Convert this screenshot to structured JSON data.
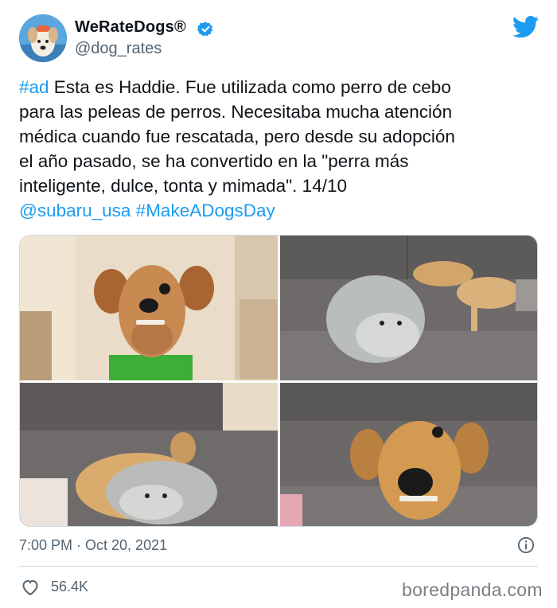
{
  "account": {
    "display_name": "WeRateDogs®",
    "handle": "@dog_rates"
  },
  "tweet": {
    "lines": [
      {
        "link": "#ad",
        "text": " Esta es Haddie. Fue utilizada como perro de cebo"
      },
      {
        "text": "para las peleas de perros. Necesitaba mucha atención"
      },
      {
        "text": "médica cuando fue rescatada, pero desde su adopción"
      },
      {
        "text": "el año pasado, se ha convertido en la \"perra más"
      },
      {
        "text": "inteligente, dulce, tonta y mimada\". 14/10"
      }
    ],
    "mentions_line": "@subaru_usa #MakeADogsDay"
  },
  "photos": [
    {
      "icon": "dog-portrait-photo"
    },
    {
      "icon": "dog-sleeping-on-seal-pillow-photo"
    },
    {
      "icon": "dog-curled-on-seal-pillow-photo"
    },
    {
      "icon": "dog-smiling-photo"
    }
  ],
  "meta": {
    "timestamp": "7:00 PM · Oct 20, 2021"
  },
  "engagement": {
    "likes": "56.4K"
  },
  "watermark": "boredpanda.com",
  "colors": {
    "link": "#1d9bf0",
    "muted": "#536471",
    "twitter_blue": "#1d9bf0"
  }
}
